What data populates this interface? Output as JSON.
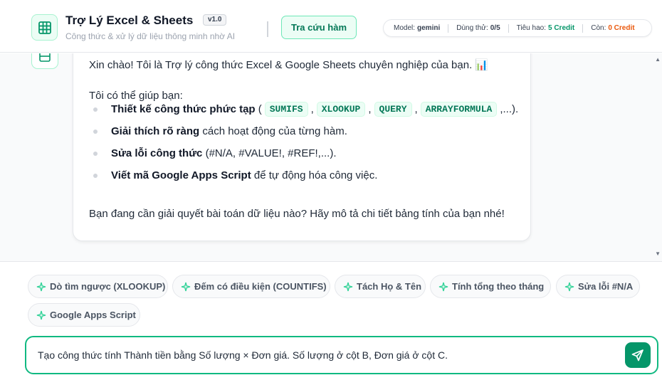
{
  "header": {
    "title": "Trợ Lý Excel & Sheets",
    "version": "v1.0",
    "subtitle": "Công thức & xử lý dữ liệu thông minh nhờ AI",
    "lookup_button": "Tra cứu hàm",
    "stats": {
      "model_label": "Model:",
      "model_value": "gemini",
      "trial_label": "Dùng thử:",
      "trial_value": "0/5",
      "cost_label": "Tiêu hao:",
      "cost_value": "5 Credit",
      "remaining_label": "Còn:",
      "remaining_value": "0 Credit"
    }
  },
  "message": {
    "greeting": "Xin chào! Tôi là Trợ lý công thức Excel & Google Sheets chuyên nghiệp của bạn. 📊",
    "intro": "Tôi có thể giúp bạn:",
    "items": [
      {
        "bold": "Thiết kế công thức phức tạp",
        "pre": " (",
        "codes": [
          "SUMIFS",
          "XLOOKUP",
          "QUERY",
          "ARRAYFORMULA"
        ],
        "rest": ",...)."
      },
      {
        "bold": "Giải thích rõ ràng",
        "rest": " cách hoạt động của từng hàm."
      },
      {
        "bold": "Sửa lỗi công thức",
        "rest": " (#N/A, #VALUE!, #REF!,...)."
      },
      {
        "bold": "Viết mã Google Apps Script",
        "rest": " để tự động hóa công việc."
      }
    ],
    "closing": "Bạn đang cần giải quyết bài toán dữ liệu nào? Hãy mô tả chi tiết bảng tính của bạn nhé!"
  },
  "suggestions": [
    "Dò tìm ngược (XLOOKUP)",
    "Đếm có điều kiện (COUNTIFS)",
    "Tách Họ & Tên",
    "Tính tổng theo tháng",
    "Sửa lỗi #N/A",
    "Google Apps Script"
  ],
  "input": {
    "value": "Tạo công thức tính Thành tiền bằng Số lượng × Đơn giá. Số lượng ở cột B, Đơn giá ở cột C."
  },
  "colors": {
    "accent": "#10b981",
    "accent_dark": "#059669",
    "warning": "#ea580c"
  }
}
